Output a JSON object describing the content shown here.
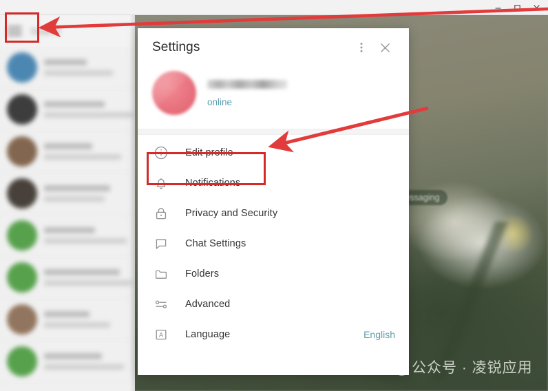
{
  "window": {
    "controls": [
      {
        "name": "minimize",
        "glyph": "minimize-icon"
      },
      {
        "name": "maximize",
        "glyph": "maximize-icon"
      },
      {
        "name": "close",
        "glyph": "close-icon"
      }
    ]
  },
  "sidebar": {
    "menu_icon": "hamburger-icon",
    "search_placeholder": "Search",
    "chat_rows": [
      {
        "avatar_color": "#3f7fad"
      },
      {
        "avatar_color": "#2e2e2e"
      },
      {
        "avatar_color": "#7a5b42"
      },
      {
        "avatar_color": "#3a332c"
      },
      {
        "avatar_color": "#4b9b3f"
      },
      {
        "avatar_color": "#4b9b3f"
      },
      {
        "avatar_color": "#8a6b52"
      },
      {
        "avatar_color": "#4b9b3f"
      }
    ]
  },
  "chat_background": {
    "pill_label": "Messaging"
  },
  "watermark": {
    "logo": "wechat-logo",
    "text": "公众号 · 凌锐应用"
  },
  "settings": {
    "title": "Settings",
    "more_icon": "more-vertical-icon",
    "close_icon": "close-icon",
    "profile": {
      "avatar": "user-avatar",
      "name": "",
      "status": "online"
    },
    "items": [
      {
        "icon": "info-circle-icon",
        "label": "Edit profile",
        "value": ""
      },
      {
        "icon": "bell-icon",
        "label": "Notifications",
        "value": ""
      },
      {
        "icon": "lock-icon",
        "label": "Privacy and Security",
        "value": ""
      },
      {
        "icon": "chat-bubble-icon",
        "label": "Chat Settings",
        "value": ""
      },
      {
        "icon": "folder-icon",
        "label": "Folders",
        "value": ""
      },
      {
        "icon": "sliders-icon",
        "label": "Advanced",
        "value": ""
      },
      {
        "icon": "language-a-icon",
        "label": "Language",
        "value": "English"
      }
    ]
  },
  "annotations": {
    "highlight_color": "#d42a2a",
    "boxes": [
      {
        "target": "hamburger-menu-button"
      },
      {
        "target": "edit-profile-menu-item"
      }
    ],
    "arrows": [
      {
        "from": "top-right",
        "to": "hamburger-menu-button"
      },
      {
        "from": "right",
        "to": "edit-profile-menu-item"
      }
    ]
  }
}
